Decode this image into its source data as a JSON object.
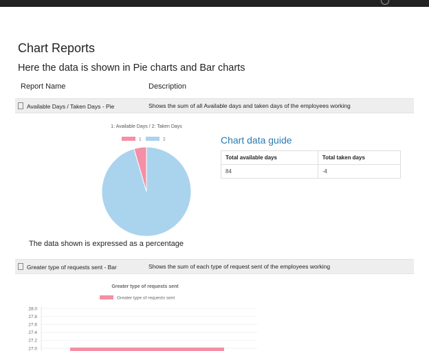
{
  "page": {
    "title": "Chart Reports",
    "subtitle": "Here the data is shown in Pie charts and Bar charts"
  },
  "table_headers": [
    "Report Name",
    "Description"
  ],
  "reports": [
    {
      "name": "Available Days / Taken Days - Pie",
      "description": "Shows the sum of all Available days and taken days of the employees working"
    },
    {
      "name": "Greater type of requests sent - Bar",
      "description": "Shows the sum of each type of request sent of the employees working"
    }
  ],
  "guide": {
    "title": "Chart data guide",
    "headers": [
      "Total available days",
      "Total taken days"
    ],
    "values": [
      "84",
      "-4"
    ]
  },
  "pie_note": "The data shown is expressed as a percentage",
  "colors": {
    "pink": "#f48fa5",
    "blue": "#aad3ee",
    "link": "#2a7ab0",
    "topbar": "#222222"
  },
  "chart_data": [
    {
      "type": "pie",
      "title": "1: Available Days / 2: Taken Days",
      "legend_position": "top",
      "series": [
        {
          "name": "1",
          "value": 4.5,
          "color": "#f48fa5"
        },
        {
          "name": "2",
          "value": 95.5,
          "color": "#aad3ee"
        }
      ]
    },
    {
      "type": "bar",
      "title": "Greater type of requests sent",
      "legend_position": "top",
      "series_name": "Greater type of requests sent",
      "color": "#f48fa5",
      "y_ticks": [
        "28.0",
        "27.8",
        "27.6",
        "27.4",
        "27.2",
        "27.0"
      ],
      "ylim_visible": [
        27.0,
        28.0
      ],
      "values": [
        27
      ]
    }
  ]
}
